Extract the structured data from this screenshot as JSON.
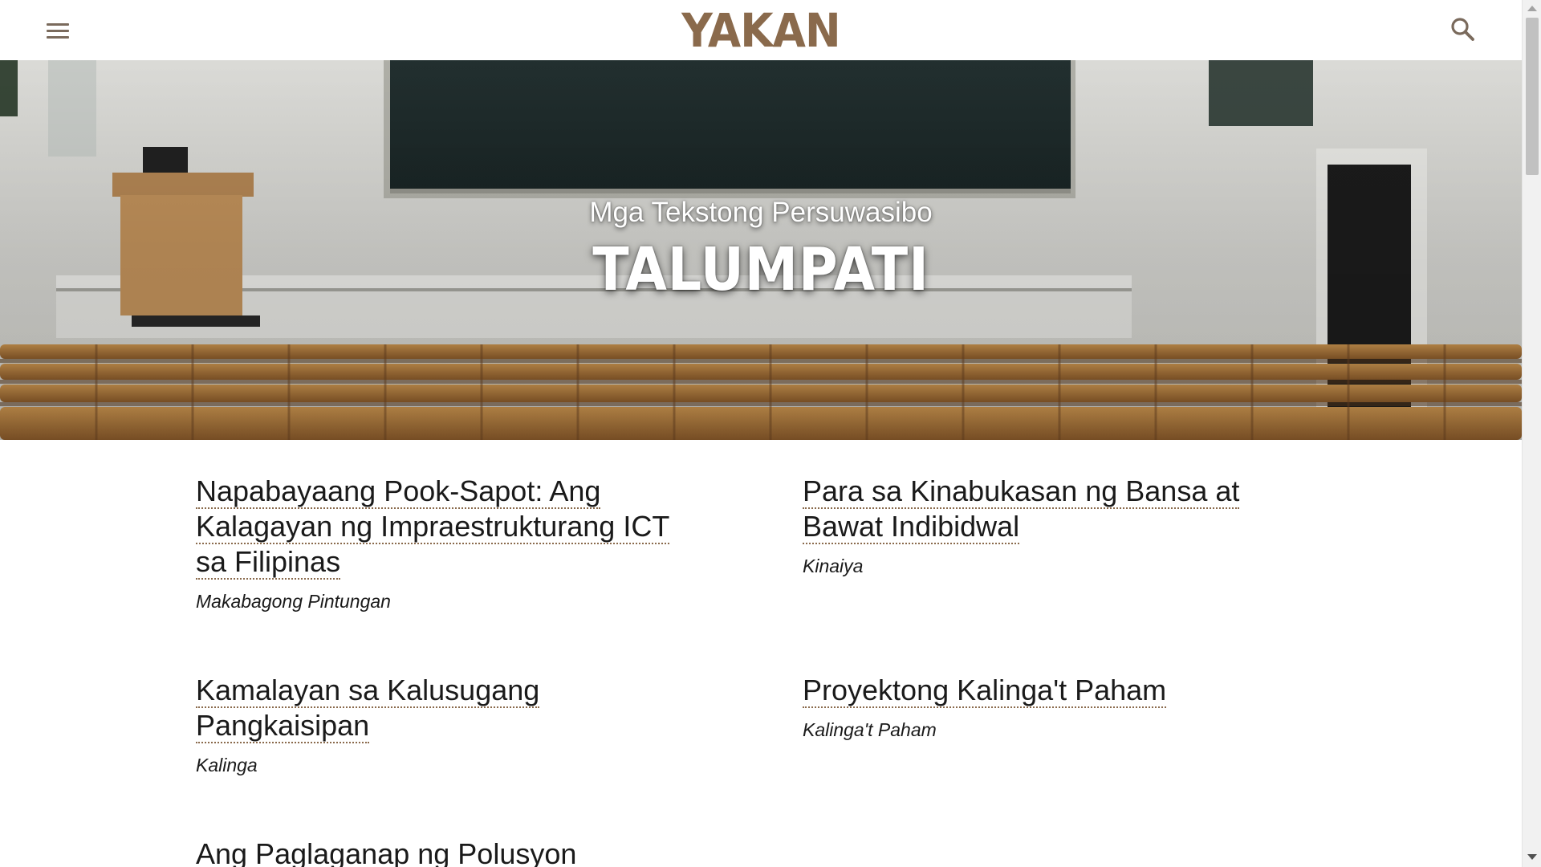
{
  "header": {
    "logo": "YAKAN",
    "menu_icon": "hamburger-menu-icon",
    "search_icon": "search-icon"
  },
  "hero": {
    "subtitle": "Mga Tekstong Persuwasibo",
    "title": "TALUMPATI",
    "image": "lecture-hall-classroom-photo"
  },
  "articles": [
    {
      "title": "Napabayaang Pook-Sapot: Ang Kalagayan ng Impraestrukturang ICT sa Filipinas",
      "category": "Makabagong Pintungan"
    },
    {
      "title": "Para sa Kinabukasan ng Bansa at Bawat Indibidwal",
      "category": "Kinaiya"
    },
    {
      "title": "Kamalayan sa Kalusugang Pangkaisipan",
      "category": "Kalinga"
    },
    {
      "title": "Proyektong Kalinga't Paham",
      "category": "Kalinga't Paham"
    },
    {
      "title": "Ang Paglaganap ng Polusyon",
      "category": ""
    }
  ],
  "colors": {
    "accent": "#8a6a4c",
    "text": "#1a1a1a",
    "background": "#ffffff"
  }
}
